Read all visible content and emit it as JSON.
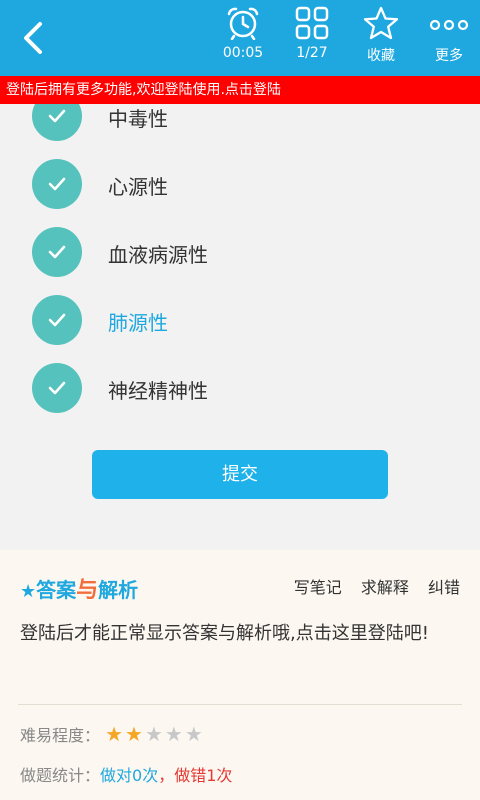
{
  "toolbar": {
    "timer": "00:05",
    "progress": "1/27",
    "favorite": "收藏",
    "more": "更多"
  },
  "banner": "登陆后拥有更多功能,欢迎登陆使用.点击登陆",
  "options": [
    {
      "text": "中毒性",
      "highlighted": false
    },
    {
      "text": "心源性",
      "highlighted": false
    },
    {
      "text": "血液病源性",
      "highlighted": false
    },
    {
      "text": "肺源性",
      "highlighted": true
    },
    {
      "text": "神经精神性",
      "highlighted": false
    }
  ],
  "submit_label": "提交",
  "answer": {
    "title_part1": "答案",
    "title_part2": "与",
    "title_part3": "解析",
    "links": [
      "写笔记",
      "求解释",
      "纠错"
    ],
    "body": "登陆后才能正常显示答案与解析哦,点击这里登陆吧!",
    "difficulty_label": "难易程度：",
    "difficulty_rating": 2,
    "difficulty_max": 5,
    "stats_label": "做题统计：",
    "stats_correct": "做对0次",
    "stats_sep": "，",
    "stats_wrong": "做错1次"
  },
  "colors": {
    "accent": "#1fa8df",
    "banner": "#ff0000",
    "check": "#55c2bd",
    "star_on": "#f5a623"
  }
}
